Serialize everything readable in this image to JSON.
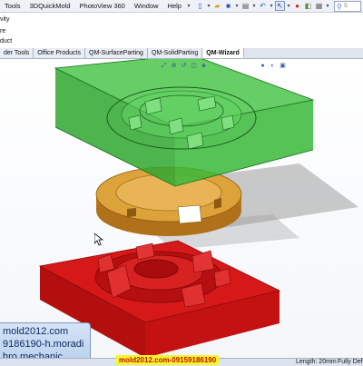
{
  "menu": {
    "items": [
      "Tools",
      "3DQuickMold",
      "PhotoView 360",
      "Window",
      "Help"
    ]
  },
  "search": {
    "value": "S"
  },
  "left_commands": [
    "vity",
    "re",
    "duct"
  ],
  "tabs": [
    "der Tools",
    "Office Products",
    "QM-SurfaceParting",
    "QM-SolidParting",
    "QM-Wizard"
  ],
  "active_tab": "QM-Wizard",
  "watermark": {
    "line1": "mold2012.com",
    "line2": "9186190-h.moradi",
    "line3": "hro.mechanic"
  },
  "status": {
    "watermark": "mold2012.com-09159186190",
    "length": "Length: 20mm",
    "defined": "Fully Defi"
  },
  "colors": {
    "cavity": "#3bbf3b",
    "core": "#d41414",
    "insert": "#d79a2c"
  },
  "icons": [
    "new-document-icon",
    "open-folder-icon",
    "save-icon",
    "print-icon",
    "undo-icon",
    "select-pointer-icon",
    "traffic-light-icon",
    "palette-icon",
    "options-icon",
    "search-icon"
  ]
}
